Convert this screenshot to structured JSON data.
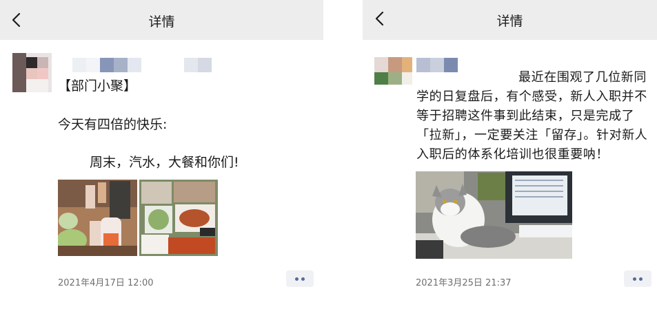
{
  "left": {
    "title": "详情",
    "heading": "【部门小聚】",
    "line1": "今天有四倍的快乐:",
    "line2": "周末，汽水，大餐和你们!",
    "timestamp": "2021年4月17日 12:00",
    "photos": [
      "party-drinks-photo",
      "food-collage-photo"
    ]
  },
  "right": {
    "title": "详情",
    "paragraph": "最近在围观了几位新同学的日复盘后，有个感受，新人入职并不等于招聘这件事到此结束，只是完成了「拉新」，一定要关注「留存」。针对新人入职后的体系化培训也很重要呐！",
    "timestamp": "2021年3月25日 21:37",
    "photos": [
      "cat-on-desk-photo"
    ]
  },
  "colors": {
    "topbar": "#ededed",
    "link_dots": "#576b95",
    "timestamp": "#6e6e6e"
  }
}
